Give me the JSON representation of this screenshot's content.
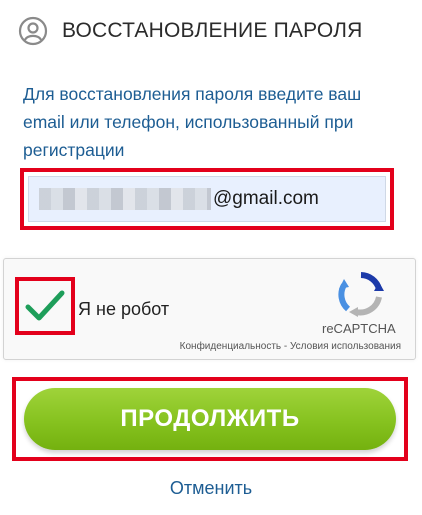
{
  "header": {
    "title": "ВОССТАНОВЛЕНИЕ ПАРОЛЯ",
    "icon": "user-circle-icon"
  },
  "instruction": {
    "text": "Для восстановления пароля введите ваш email или телефон, использованный при регистрации"
  },
  "email_field": {
    "value_visible": "@gmail.com",
    "redacted_prefix": true
  },
  "recaptcha": {
    "checked": true,
    "label": "Я не робот",
    "brand": "reCAPTCHA",
    "privacy_link": "Конфиденциальность",
    "separator": " - ",
    "terms_link": "Условия использования"
  },
  "continue_button": {
    "label": "ПРОДОЛЖИТЬ"
  },
  "cancel_link": {
    "label": "Отменить"
  },
  "colors": {
    "accent_blue": "#1d5d93",
    "button_green": "#86c21f",
    "highlight_red": "#e3001b",
    "check_green": "#1e9e5a"
  }
}
